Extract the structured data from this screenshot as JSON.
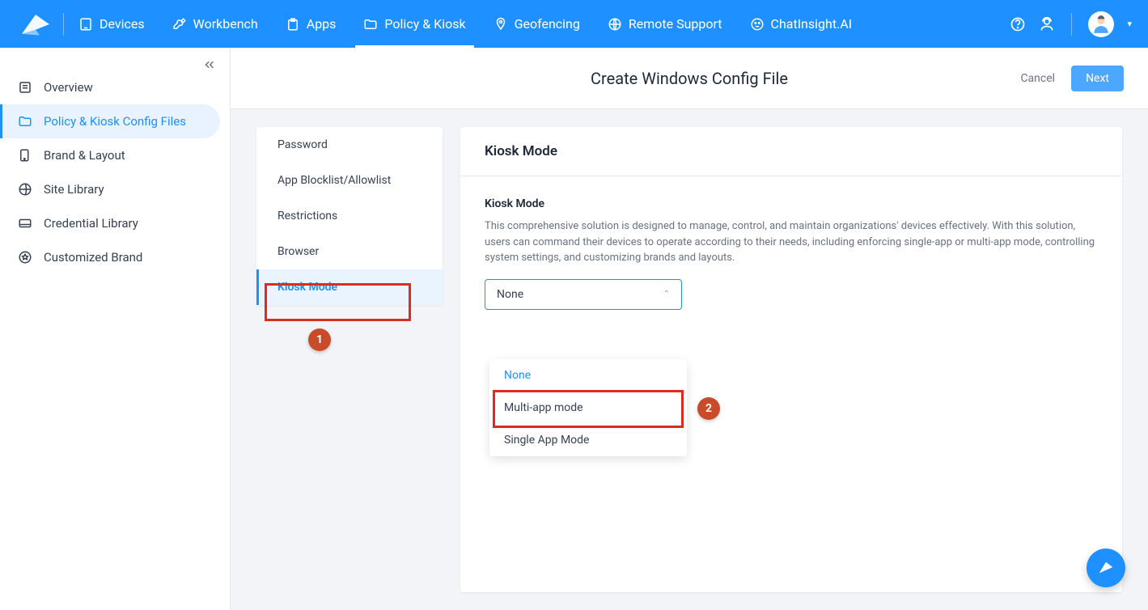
{
  "topnav": {
    "items": [
      {
        "label": "Devices"
      },
      {
        "label": "Workbench"
      },
      {
        "label": "Apps"
      },
      {
        "label": "Policy & Kiosk"
      },
      {
        "label": "Geofencing"
      },
      {
        "label": "Remote Support"
      },
      {
        "label": "ChatInsight.AI"
      }
    ]
  },
  "sidebar": {
    "items": [
      {
        "label": "Overview"
      },
      {
        "label": "Policy & Kiosk Config Files"
      },
      {
        "label": "Brand & Layout"
      },
      {
        "label": "Site Library"
      },
      {
        "label": "Credential Library"
      },
      {
        "label": "Customized Brand"
      }
    ]
  },
  "page": {
    "title": "Create Windows Config File",
    "cancel": "Cancel",
    "next": "Next"
  },
  "configMenu": {
    "items": [
      "Password",
      "App Blocklist/Allowlist",
      "Restrictions",
      "Browser",
      "Kiosk Mode"
    ]
  },
  "panel": {
    "title": "Kiosk Mode",
    "fieldLabel": "Kiosk Mode",
    "description": "This comprehensive solution is designed to manage, control, and maintain organizations' devices effectively. With this solution, users can command their devices to operate according to their needs, including enforcing single-app or multi-app mode, controlling system settings, and customizing brands and layouts.",
    "selectValue": "None",
    "options": [
      "None",
      "Multi-app mode",
      "Single App Mode"
    ]
  },
  "badges": {
    "one": "1",
    "two": "2"
  }
}
